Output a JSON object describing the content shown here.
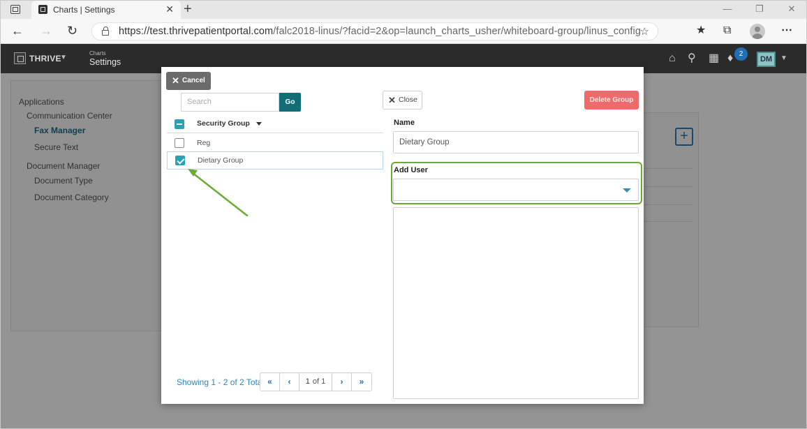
{
  "browser": {
    "tab_title": "Charts | Settings",
    "tab_close": "✕",
    "new_tab": "+",
    "url_host": "https://test.thrivepatientportal.com",
    "url_path": "/falc2018-linus/?facid=2&op=launch_charts_usher/whiteboard-group/linus_config",
    "window_controls": [
      "—",
      "❐",
      "✕"
    ]
  },
  "app": {
    "brand": "THRIVE",
    "breadcrumb_small": "Charts",
    "breadcrumb_title": "Settings",
    "notification_count": "2",
    "user_initials": "DM"
  },
  "leftnav": {
    "items": [
      {
        "label": "Applications"
      },
      {
        "label": "Communication Center"
      },
      {
        "label": "Fax Manager",
        "active": true
      },
      {
        "label": "Secure Text"
      },
      {
        "label": "Document Manager"
      },
      {
        "label": "Document Type"
      },
      {
        "label": "Document Category"
      }
    ]
  },
  "background": {
    "add_symbol": "+"
  },
  "modal": {
    "cancel_label": "Cancel",
    "search_placeholder": "Search",
    "go_label": "Go",
    "close_label": "Close",
    "delete_label": "Delete Group",
    "list_header": "Security Group",
    "rows": [
      {
        "label": "Reg",
        "checked": false
      },
      {
        "label": "Dietary Group",
        "checked": true
      }
    ],
    "pager_text": "Showing 1 - 2 of 2 Total",
    "pager": {
      "current": "1",
      "of": "of 1"
    },
    "name_label": "Name",
    "name_value": "Dietary Group",
    "add_user_label": "Add User",
    "add_user_value": ""
  },
  "colors": {
    "accent_teal": "#116e77",
    "delete_red": "#ee6b6b",
    "highlight_green": "#6aaa35",
    "link_blue": "#2b86c5"
  }
}
